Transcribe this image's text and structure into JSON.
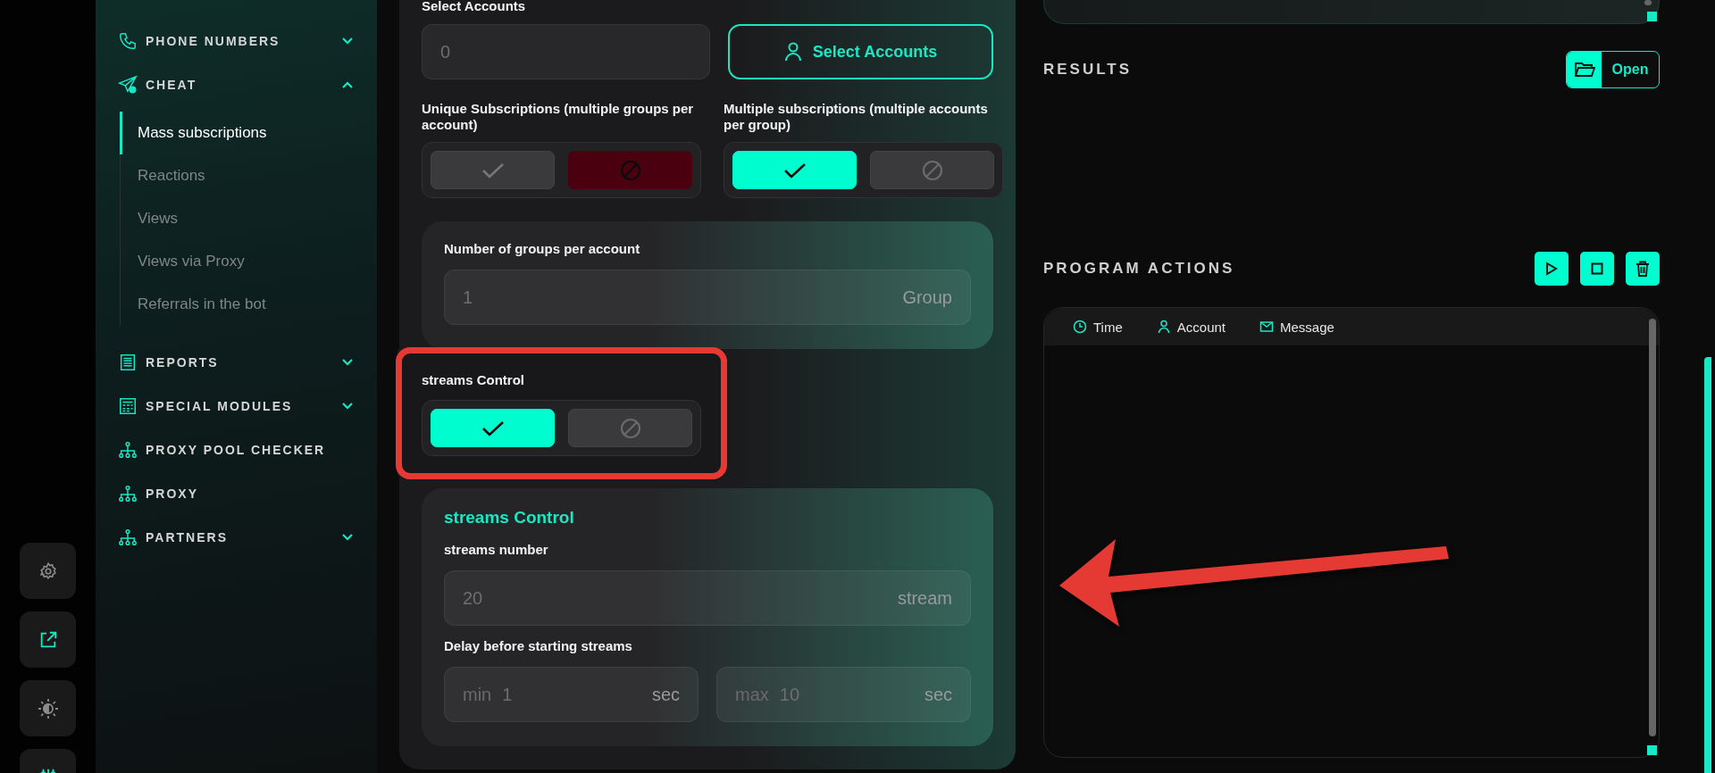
{
  "rail": [
    {
      "selected": false
    },
    {
      "selected": true
    },
    {
      "selected": false
    },
    {
      "selected": true
    }
  ],
  "sidebar": {
    "items": [
      {
        "label": "PHONE NUMBERS",
        "expanded": false
      },
      {
        "label": "CHEAT",
        "expanded": true,
        "children": [
          {
            "label": "Mass subscriptions",
            "selected": true
          },
          {
            "label": "Reactions",
            "selected": false
          },
          {
            "label": "Views",
            "selected": false
          },
          {
            "label": "Views via Proxy",
            "selected": false
          },
          {
            "label": "Referrals in the bot",
            "selected": false
          }
        ]
      },
      {
        "label": "REPORTS",
        "expanded": false
      },
      {
        "label": "SPECIAL MODULES",
        "expanded": false
      },
      {
        "label": "PROXY POOL CHECKER"
      },
      {
        "label": "PROXY"
      },
      {
        "label": "PARTNERS",
        "expanded": false
      }
    ]
  },
  "main": {
    "select_accounts": {
      "label": "Select Accounts",
      "value": "0",
      "button": "Select Accounts"
    },
    "toggles": [
      {
        "label": "Unique Subscriptions (multiple groups per account)",
        "checked": false
      },
      {
        "label": "Multiple subscriptions (multiple accounts per group)",
        "checked": true
      }
    ],
    "groups_card": {
      "label": "Number of groups per account",
      "value": "1",
      "unit": "Group"
    },
    "streams_toggle": {
      "label": "streams Control",
      "checked": true
    },
    "streams_card": {
      "title": "streams Control",
      "number_label": "streams number",
      "number": {
        "value": "20",
        "unit": "stream"
      },
      "delay_label": "Delay before starting streams",
      "delay": [
        {
          "prefix": "min",
          "value": "1",
          "unit": "sec"
        },
        {
          "prefix": "max",
          "value": "10",
          "unit": "sec"
        }
      ]
    }
  },
  "results": {
    "title": "RESULTS",
    "button": "Open"
  },
  "program_actions": {
    "title": "PROGRAM ACTIONS",
    "columns": [
      "Time",
      "Account",
      "Message"
    ]
  }
}
